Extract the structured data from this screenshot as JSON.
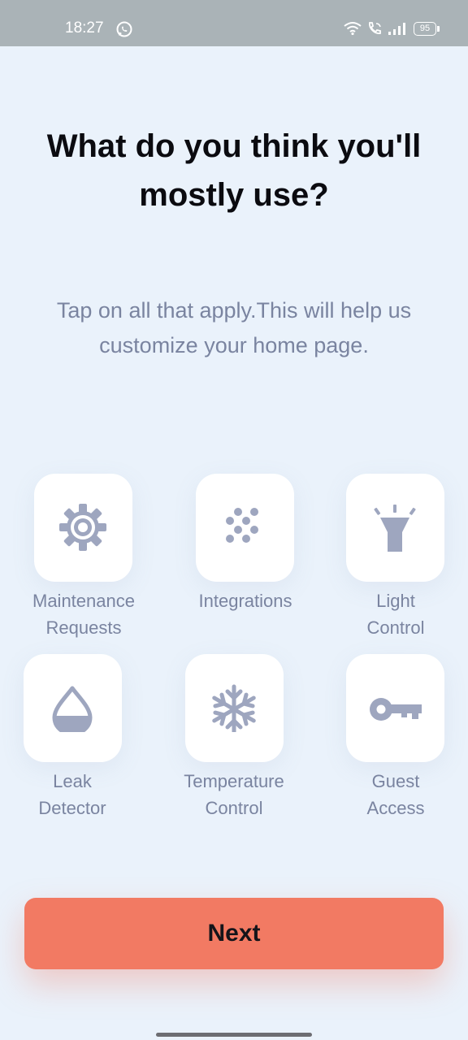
{
  "status_bar": {
    "time": "18:27",
    "battery": "95"
  },
  "page": {
    "title": "What do you think you'll mostly use?",
    "subtitle_line1": "Tap on all that apply.This will help us",
    "subtitle_line2": "customize your home page."
  },
  "options": [
    {
      "icon": "gear-icon",
      "line1": "Maintenance",
      "line2": "Requests"
    },
    {
      "icon": "dots-icon",
      "line1": "Integrations",
      "line2": ""
    },
    {
      "icon": "flashlight-icon",
      "line1": "Light",
      "line2": "Control"
    },
    {
      "icon": "water-drop-icon",
      "line1": "Leak",
      "line2": "Detector"
    },
    {
      "icon": "snowflake-icon",
      "line1": "Temperature",
      "line2": "Control"
    },
    {
      "icon": "key-icon",
      "line1": "Guest",
      "line2": "Access"
    }
  ],
  "next_button": {
    "label": "Next"
  },
  "colors": {
    "background": "#eaf2fb",
    "accent": "#f27a63",
    "icon": "#9ea6bf",
    "label": "#7a84a0"
  }
}
